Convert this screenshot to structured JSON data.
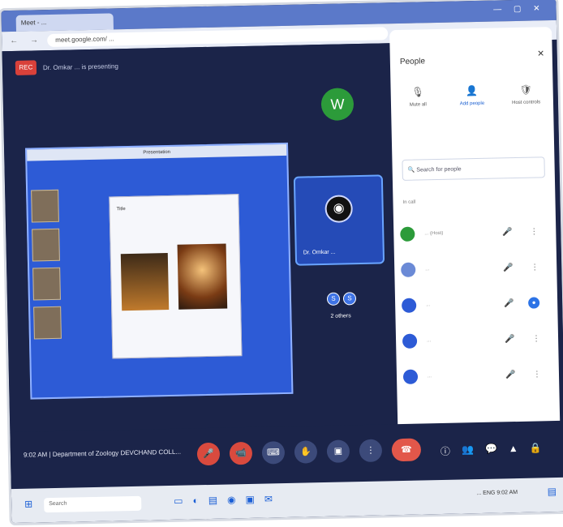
{
  "browser": {
    "tab_title": "Meet - ... ",
    "window_controls": "— ▢ ✕",
    "nav_controls": "← → ↻",
    "url": "meet.google.com/ ... "
  },
  "meeting": {
    "rec_badge": "REC",
    "presenting_text": "Dr. Omkar ... is presenting",
    "share_window_title": "Presentation",
    "slide_text": "Title",
    "tiles": {
      "avatar_letter": "W",
      "presenter_name": "Dr. Omkar ...",
      "others_count": "2 others",
      "others_initials": [
        "S",
        "S"
      ]
    },
    "footer_info": "9:02 AM | Department of Zoology DEVCHAND COLL..."
  },
  "people_panel": {
    "title": "People",
    "close_icon": "×",
    "actions": [
      {
        "label": "Mute all",
        "icon": "mic-off-icon"
      },
      {
        "label": "Add people",
        "icon": "person-add-icon"
      },
      {
        "label": "Host controls",
        "icon": "shield-icon"
      }
    ],
    "search_placeholder": "Search for people",
    "section_label": "In call",
    "people": [
      {
        "initial": "",
        "name": "... (Host)",
        "avatar_color": "#2c9b3a"
      },
      {
        "initial": "",
        "name": "...",
        "avatar_color": "#6b8ad6"
      },
      {
        "initial": "",
        "name": "...",
        "avatar_color": "#2d5bd6"
      },
      {
        "initial": "",
        "name": "...",
        "avatar_color": "#2d5bd6"
      },
      {
        "initial": "",
        "name": "...",
        "avatar_color": "#2d5bd6"
      }
    ]
  },
  "controls": {
    "center": [
      "🎤",
      "📹",
      "⌨",
      "✋",
      "▣",
      "⋮",
      "☎"
    ],
    "right": [
      "ⓘ",
      "👥",
      "💬",
      "▲",
      "🔒"
    ]
  },
  "taskbar": {
    "search_placeholder": "Search",
    "tray_text": "... ENG 9:02 AM"
  }
}
